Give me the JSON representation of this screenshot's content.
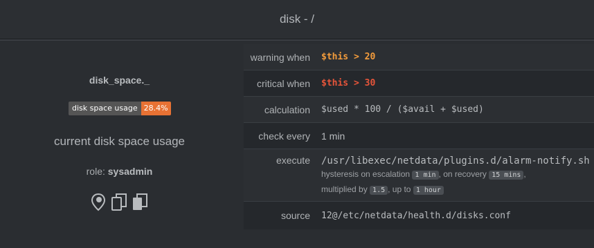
{
  "header": {
    "title": "disk - /"
  },
  "alarm": {
    "name": "disk_space._",
    "badge_label": "disk space usage",
    "badge_value": "28.4%",
    "info": "current disk space usage",
    "role_label": "role:",
    "role_value": "sysadmin",
    "icons": [
      "map-pin-icon",
      "copy-icon",
      "copy-all-icon"
    ]
  },
  "details": {
    "warning_label": "warning when",
    "warning_value": "$this > 20",
    "critical_label": "critical when",
    "critical_value": "$this > 30",
    "calculation_label": "calculation",
    "calculation_value": "$used * 100 / ($avail + $used)",
    "check_label": "check every",
    "check_value": "1 min",
    "execute_label": "execute",
    "execute_value": "/usr/libexec/netdata/plugins.d/alarm-notify.sh",
    "hyst_prefix": "hysteresis on escalation",
    "hyst_escalation": "1 min",
    "hyst_mid": ", on recovery",
    "hyst_recovery": "15 mins",
    "hyst_comma": ",",
    "mult_prefix": "multiplied by",
    "mult_value": "1.5",
    "upto_text": ", up to",
    "upto_value": "1 hour",
    "source_label": "source",
    "source_value": "12@/etc/netdata/health.d/disks.conf"
  },
  "colors": {
    "warning": "#f39c3c",
    "critical": "#e8553a",
    "badge_value_bg": "#e87234"
  }
}
